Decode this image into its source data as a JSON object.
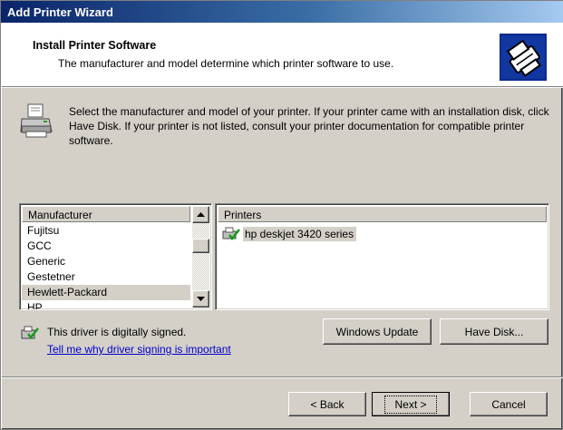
{
  "window": {
    "title": "Add Printer Wizard"
  },
  "header": {
    "title": "Install Printer Software",
    "subtitle": "The manufacturer and model determine which printer software to use."
  },
  "intro": {
    "text": "Select the manufacturer and model of your printer. If your printer came with an installation disk, click Have Disk. If your printer is not listed, consult your printer documentation for compatible printer software."
  },
  "manufacturers": {
    "header": "Manufacturer",
    "items": [
      "Fujitsu",
      "GCC",
      "Generic",
      "Gestetner",
      "Hewlett-Packard",
      "HP"
    ],
    "selected": "Hewlett-Packard"
  },
  "printers": {
    "header": "Printers",
    "items": [
      "hp deskjet 3420 series"
    ],
    "selected": "hp deskjet 3420 series"
  },
  "signing": {
    "status": "This driver is digitally signed.",
    "link": "Tell me why driver signing is important"
  },
  "buttons": {
    "windows_update": "Windows Update",
    "have_disk": "Have Disk...",
    "back": "< Back",
    "next": "Next >",
    "cancel": "Cancel"
  },
  "colors": {
    "title_gradient_start": "#0a246a",
    "title_gradient_end": "#a6caf0",
    "face": "#d4d0c8",
    "link": "#0000cc"
  },
  "icons": {
    "header": "printer-wizard-icon",
    "intro": "printer-icon",
    "signed": "signed-driver-icon"
  }
}
